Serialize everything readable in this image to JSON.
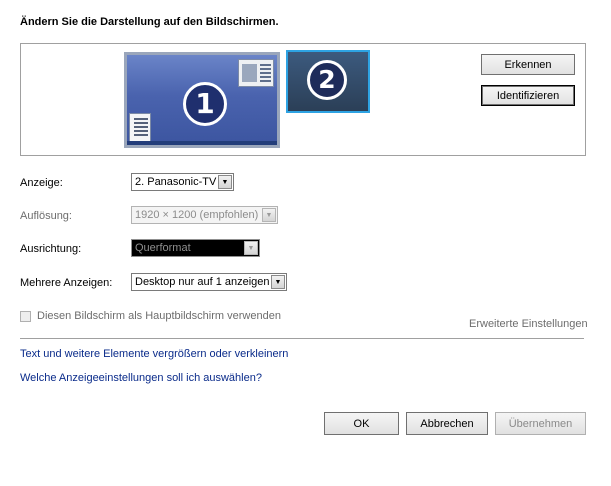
{
  "heading": "Ändern Sie die Darstellung auf den Bildschirmen.",
  "preview": {
    "monitor1_number": "1",
    "monitor2_number": "2",
    "detect_button": "Erkennen",
    "identify_button": "Identifizieren"
  },
  "fields": {
    "display_label": "Anzeige:",
    "display_value": "2. Panasonic-TV",
    "resolution_label": "Auflösung:",
    "resolution_value": "1920 × 1200 (empfohlen)",
    "orientation_label": "Ausrichtung:",
    "orientation_value": "Querformat",
    "multi_label": "Mehrere Anzeigen:",
    "multi_value": "Desktop nur auf 1 anzeigen"
  },
  "primary_checkbox_label": "Diesen Bildschirm als Hauptbildschirm verwenden",
  "advanced_link": "Erweiterte Einstellungen",
  "links": {
    "text_size": "Text und weitere Elemente vergrößern oder verkleinern",
    "which_settings": "Welche Anzeigeeinstellungen soll ich auswählen?"
  },
  "buttons": {
    "ok": "OK",
    "cancel": "Abbrechen",
    "apply": "Übernehmen"
  },
  "icons": {
    "dropdown_arrow": "▼"
  },
  "colors": {
    "link": "#0a2b8a",
    "selected_monitor_border": "#2ea3e3"
  }
}
